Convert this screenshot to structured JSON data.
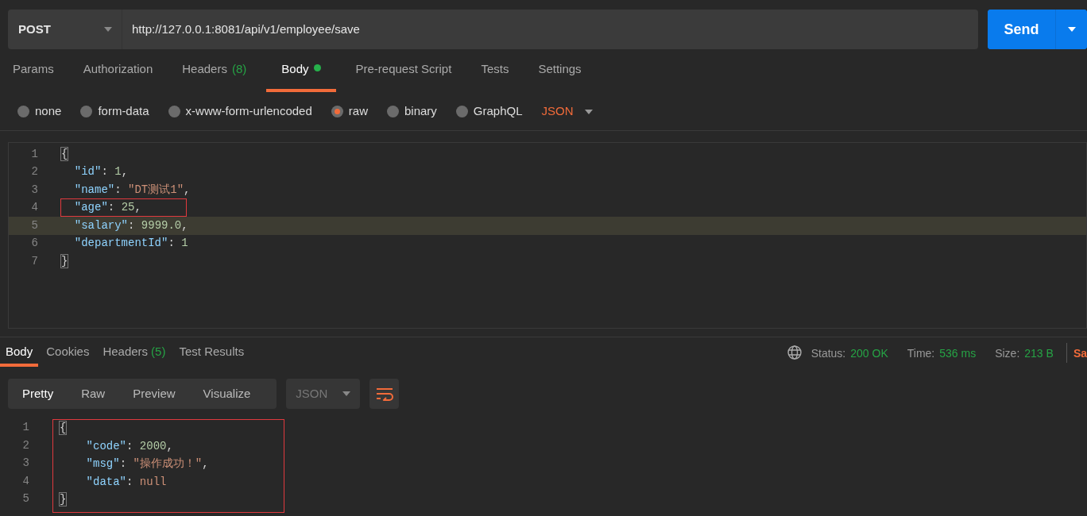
{
  "request": {
    "method": "POST",
    "url": "http://127.0.0.1:8081/api/v1/employee/save",
    "send": "Send"
  },
  "request_tabs": [
    {
      "label": "Params",
      "selected": false,
      "indicator": false
    },
    {
      "label": "Authorization",
      "selected": false,
      "indicator": false
    },
    {
      "label": "Headers",
      "count": "(8)",
      "selected": false,
      "indicator": false
    },
    {
      "label": "Body",
      "selected": true,
      "indicator": true
    },
    {
      "label": "Pre-request Script",
      "selected": false,
      "indicator": false
    },
    {
      "label": "Tests",
      "selected": false,
      "indicator": false
    },
    {
      "label": "Settings",
      "selected": false,
      "indicator": false
    }
  ],
  "body_types": [
    {
      "label": "none",
      "selected": false
    },
    {
      "label": "form-data",
      "selected": false
    },
    {
      "label": "x-www-form-urlencoded",
      "selected": false
    },
    {
      "label": "raw",
      "selected": true
    },
    {
      "label": "binary",
      "selected": false
    },
    {
      "label": "GraphQL",
      "selected": false
    }
  ],
  "body_format": "JSON",
  "request_body": [
    {
      "number": "1",
      "highlighted": false,
      "boxed": false,
      "tokens": [
        {
          "kind": "bracket",
          "text": "{"
        }
      ]
    },
    {
      "number": "2",
      "highlighted": false,
      "boxed": false,
      "tokens": [
        {
          "kind": "key",
          "text": "  \"id\""
        },
        {
          "kind": "punct",
          "text": ": "
        },
        {
          "kind": "number",
          "text": "1"
        },
        {
          "kind": "punct",
          "text": ","
        }
      ]
    },
    {
      "number": "3",
      "highlighted": false,
      "boxed": false,
      "tokens": [
        {
          "kind": "key",
          "text": "  \"name\""
        },
        {
          "kind": "punct",
          "text": ": "
        },
        {
          "kind": "string",
          "text": "\"DT测试1\""
        },
        {
          "kind": "punct",
          "text": ","
        }
      ]
    },
    {
      "number": "4",
      "highlighted": false,
      "boxed": true,
      "tokens": [
        {
          "kind": "key",
          "text": "  \"age\""
        },
        {
          "kind": "punct",
          "text": ": "
        },
        {
          "kind": "number",
          "text": "25"
        },
        {
          "kind": "punct",
          "text": ","
        }
      ]
    },
    {
      "number": "5",
      "highlighted": true,
      "boxed": false,
      "tokens": [
        {
          "kind": "key",
          "text": "  \"salary\""
        },
        {
          "kind": "punct",
          "text": ": "
        },
        {
          "kind": "number",
          "text": "9999.0"
        },
        {
          "kind": "punct",
          "text": ","
        }
      ]
    },
    {
      "number": "6",
      "highlighted": false,
      "boxed": false,
      "tokens": [
        {
          "kind": "key",
          "text": "  \"departmentId\""
        },
        {
          "kind": "punct",
          "text": ": "
        },
        {
          "kind": "number",
          "text": "1"
        }
      ]
    },
    {
      "number": "7",
      "highlighted": false,
      "boxed": false,
      "tokens": [
        {
          "kind": "bracket",
          "text": "}"
        }
      ]
    }
  ],
  "response_tabs": [
    {
      "label": "Body",
      "selected": true
    },
    {
      "label": "Cookies",
      "selected": false
    },
    {
      "label": "Headers",
      "count": "(5)",
      "selected": false
    },
    {
      "label": "Test Results",
      "selected": false
    }
  ],
  "response_status": [
    {
      "label": "Status:",
      "value": "200 OK"
    },
    {
      "label": "Time:",
      "value": "536 ms"
    },
    {
      "label": "Size:",
      "value": "213 B"
    }
  ],
  "response_action": "Sa",
  "view_modes": [
    {
      "label": "Pretty",
      "selected": true
    },
    {
      "label": "Raw",
      "selected": false
    },
    {
      "label": "Preview",
      "selected": false
    },
    {
      "label": "Visualize",
      "selected": false
    }
  ],
  "response_format": "JSON",
  "response_boxed": true,
  "response_body": [
    {
      "number": "1",
      "tokens": [
        {
          "kind": "bracket",
          "text": "{"
        }
      ]
    },
    {
      "number": "2",
      "tokens": [
        {
          "kind": "key",
          "text": "    \"code\""
        },
        {
          "kind": "punct",
          "text": ": "
        },
        {
          "kind": "number",
          "text": "2000"
        },
        {
          "kind": "punct",
          "text": ","
        }
      ]
    },
    {
      "number": "3",
      "tokens": [
        {
          "kind": "key",
          "text": "    \"msg\""
        },
        {
          "kind": "punct",
          "text": ": "
        },
        {
          "kind": "string",
          "text": "\"操作成功！\""
        },
        {
          "kind": "punct",
          "text": ","
        }
      ]
    },
    {
      "number": "4",
      "tokens": [
        {
          "kind": "key",
          "text": "    \"data\""
        },
        {
          "kind": "punct",
          "text": ": "
        },
        {
          "kind": "string",
          "text": "null"
        }
      ]
    },
    {
      "number": "5",
      "tokens": [
        {
          "kind": "bracket",
          "text": "}"
        }
      ]
    }
  ]
}
